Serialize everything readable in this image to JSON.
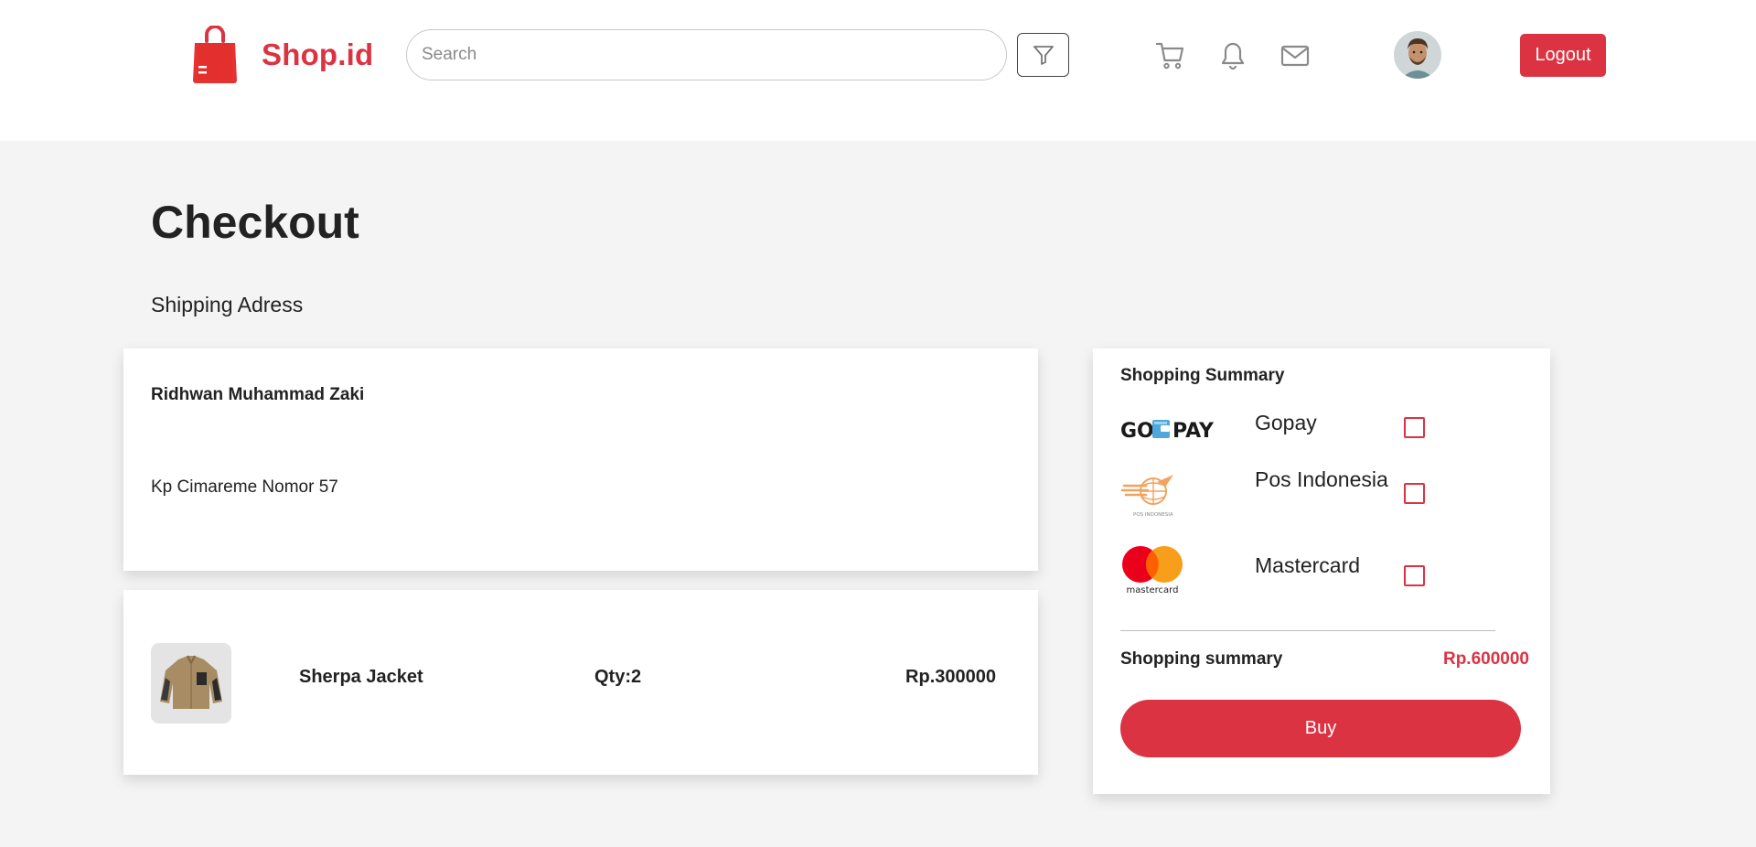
{
  "brand": {
    "name": "Shop.id",
    "logo_icon": "shopping-bag-icon",
    "color": "#db3342"
  },
  "header": {
    "search_placeholder": "Search",
    "search_value": "",
    "filter_icon": "filter-icon",
    "icons": [
      "cart-icon",
      "bell-icon",
      "mail-icon"
    ],
    "avatar": "user-avatar",
    "logout_label": "Logout"
  },
  "page": {
    "title": "Checkout",
    "shipping_label": "Shipping Adress"
  },
  "address": {
    "name": "Ridhwan Muhammad Zaki",
    "line": "Kp Cimareme Nomor 57"
  },
  "order": {
    "items": [
      {
        "name": "Sherpa Jacket",
        "qty": "Qty:2",
        "price": "Rp.300000",
        "thumb": "jacket-image"
      }
    ]
  },
  "summary": {
    "title": "Shopping Summary",
    "payments": [
      {
        "logo": "gopay-logo",
        "logo_text": "GOPAY",
        "label": "Gopay",
        "checked": false
      },
      {
        "logo": "pos-indonesia-logo",
        "logo_text": "POS INDONESIA",
        "label": "Pos Indonesia",
        "checked": false
      },
      {
        "logo": "mastercard-logo",
        "logo_text": "mastercard",
        "label": "Mastercard",
        "checked": false
      }
    ],
    "total_label": "Shopping summary",
    "total_value": "Rp.600000",
    "buy_label": "Buy"
  },
  "colors": {
    "accent": "#db3342",
    "page_bg": "#f4f4f4",
    "card_bg": "#ffffff",
    "text": "#222222"
  }
}
